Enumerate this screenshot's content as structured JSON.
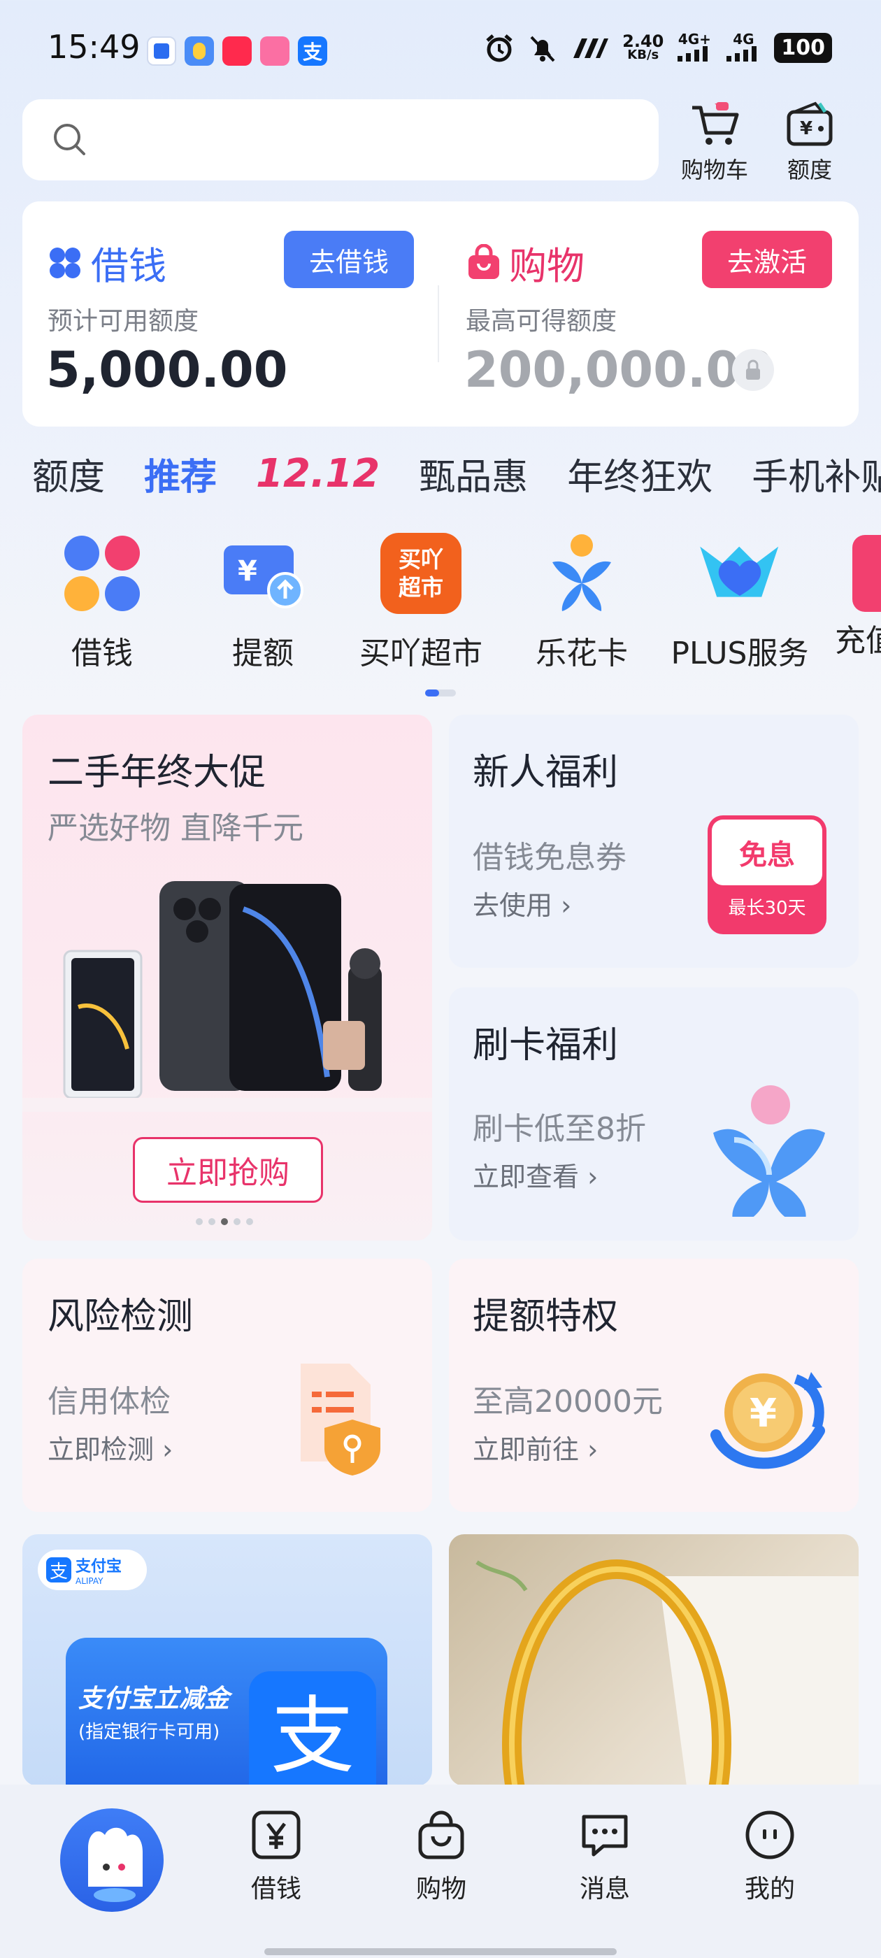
{
  "status_bar": {
    "time": "15:49",
    "net_speed": "2.40",
    "net_unit": "KB/s",
    "sig1": "4G+",
    "sig2": "4G",
    "battery": "100"
  },
  "header": {
    "cart_label": "购物车",
    "quota_label": "额度"
  },
  "credit": {
    "borrow": {
      "title": "借钱",
      "button": "去借钱",
      "subtitle": "预计可用额度",
      "amount": "5,000.00"
    },
    "shop": {
      "title": "购物",
      "button": "去激活",
      "subtitle": "最高可得额度",
      "amount": "200,000.00"
    }
  },
  "tabs": [
    "额度",
    "推荐",
    "12.12",
    "甄品惠",
    "年终狂欢",
    "手机补贴"
  ],
  "services": [
    "借钱",
    "提额",
    "买吖超市",
    "乐花卡",
    "PLUS服务",
    "充值"
  ],
  "service_icon_text": {
    "supermarket": "买吖\n超市"
  },
  "cards": {
    "promo": {
      "title": "二手年终大促",
      "subtitle": "严选好物 直降千元",
      "button": "立即抢购"
    },
    "newbie": {
      "title": "新人福利",
      "subtitle": "借钱免息券",
      "link": "去使用",
      "coupon_main": "免息",
      "coupon_sub": "最长30天"
    },
    "card_benefit": {
      "title": "刷卡福利",
      "subtitle": "刷卡低至8折",
      "link": "立即查看"
    },
    "risk": {
      "title": "风险检测",
      "subtitle": "信用体检",
      "link": "立即检测"
    },
    "raise": {
      "title": "提额特权",
      "subtitle": "至高20000元",
      "link": "立即前往"
    },
    "alipay": {
      "logo": "支付宝",
      "logo_en": "ALIPAY",
      "line1": "支付宝立减金",
      "line2": "(指定银行卡可用)"
    }
  },
  "bottom_nav": [
    "借钱",
    "购物",
    "消息",
    "我的"
  ],
  "colors": {
    "accent_blue": "#3b6ef5",
    "accent_pink": "#e8336a"
  }
}
